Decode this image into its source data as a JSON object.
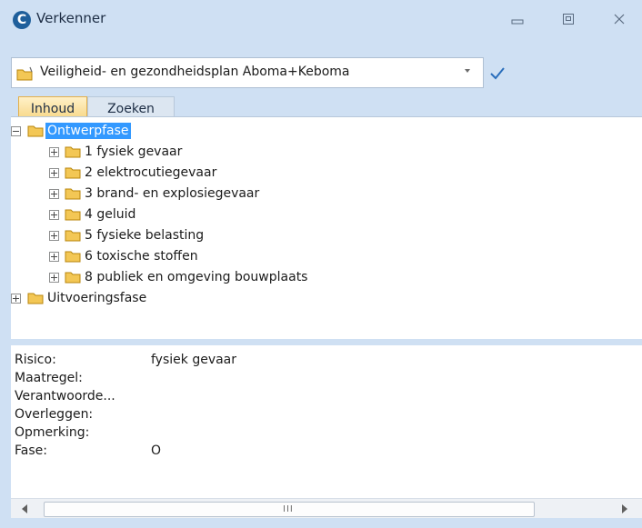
{
  "window": {
    "title": "Verkenner",
    "app_icon_letter": "C"
  },
  "path": {
    "value": "Veiligheid- en gezondheidsplan Aboma+Keboma"
  },
  "tabs": [
    {
      "label": "Inhoud",
      "active": true
    },
    {
      "label": "Zoeken",
      "active": false
    }
  ],
  "tree": {
    "root": {
      "label": "Ontwerpfase",
      "expanded": true,
      "selected": true
    },
    "children": [
      {
        "label": "1  fysiek gevaar"
      },
      {
        "label": "2  elektrocutiegevaar"
      },
      {
        "label": "3  brand- en explosiegevaar"
      },
      {
        "label": "4  geluid"
      },
      {
        "label": "5  fysieke belasting"
      },
      {
        "label": "6  toxische stoffen"
      },
      {
        "label": "8  publiek en omgeving bouwplaats"
      }
    ],
    "sibling": {
      "label": "Uitvoeringsfase",
      "expanded": false
    }
  },
  "details": [
    {
      "key": "Risico:",
      "value": "fysiek gevaar"
    },
    {
      "key": "Maatregel:",
      "value": ""
    },
    {
      "key": "Verantwoorde...",
      "value": ""
    },
    {
      "key": "Overleggen:",
      "value": ""
    },
    {
      "key": "Opmerking:",
      "value": ""
    },
    {
      "key": "Fase:",
      "value": "O"
    }
  ],
  "scrollbar": {
    "grip": "III"
  },
  "colors": {
    "chrome": "#cfe0f3",
    "selection": "#3399ff",
    "folder": "#f3c755",
    "apply_check": "#2a6ebb"
  },
  "icons": [
    "app-logo-icon",
    "minimize-icon",
    "maximize-icon",
    "close-icon",
    "folder-icon",
    "dropdown-arrow-icon",
    "checkmark-icon",
    "expand-icon",
    "collapse-icon",
    "scroll-left-icon",
    "scroll-right-icon"
  ]
}
